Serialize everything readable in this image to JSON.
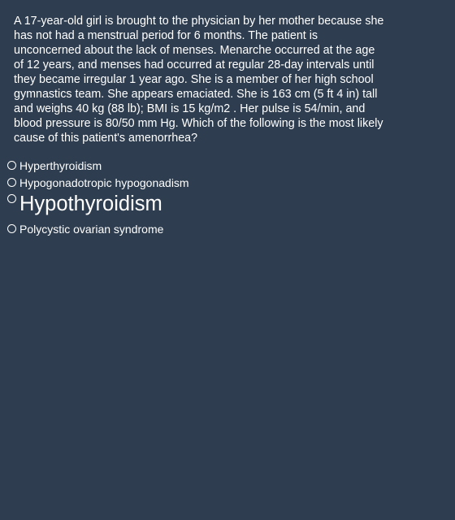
{
  "question": {
    "text": "A 17-year-old girl is brought to the physician by her mother because she has not had a menstrual period for 6 months. The patient is unconcerned about the lack of menses. Menarche occurred at the age of 12 years, and menses had occurred at regular 28-day intervals until they became irregular 1 year ago. She is a member of her high school gymnastics team. She appears emaciated. She is 163 cm (5 ft 4 in) tall and weighs 40 kg (88 lb); BMI is 15 kg/m2 . Her pulse is 54/min, and blood pressure is 80/50 mm Hg. Which of the following is the most likely cause of this patient's amenorrhea?"
  },
  "options": [
    {
      "label": "Hyperthyroidism",
      "selected": false
    },
    {
      "label": "Hypogonadotropic hypogonadism",
      "selected": false
    },
    {
      "label": "Hypothyroidism",
      "selected": false
    },
    {
      "label": "Polycystic ovarian syndrome",
      "selected": false
    }
  ],
  "colors": {
    "background": "#2e3d4f",
    "text": "#ffffff"
  }
}
